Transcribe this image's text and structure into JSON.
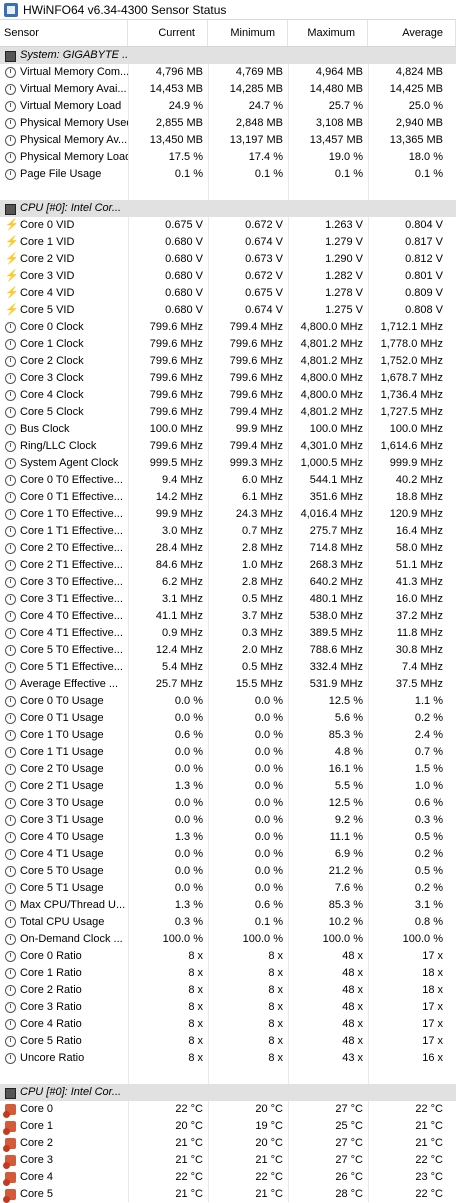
{
  "window": {
    "title": "HWiNFO64 v6.34-4300 Sensor Status"
  },
  "columns": [
    "Sensor",
    "Current",
    "Minimum",
    "Maximum",
    "Average"
  ],
  "colors": {
    "group_bg": "#e1e1e1",
    "voltage_icon": "#f4b400",
    "temp_icon": "#c23b20"
  },
  "rows": [
    {
      "type": "group",
      "icon": "chip-icon",
      "name": "System: GIGABYTE ..."
    },
    {
      "type": "data",
      "icon": "gauge-icon",
      "name": "Virtual Memory Com...",
      "cur": "4,796 MB",
      "min": "4,769 MB",
      "max": "4,964 MB",
      "avg": "4,824 MB"
    },
    {
      "type": "data",
      "icon": "gauge-icon",
      "name": "Virtual Memory Avai...",
      "cur": "14,453 MB",
      "min": "14,285 MB",
      "max": "14,480 MB",
      "avg": "14,425 MB"
    },
    {
      "type": "data",
      "icon": "gauge-icon",
      "name": "Virtual Memory Load",
      "cur": "24.9 %",
      "min": "24.7 %",
      "max": "25.7 %",
      "avg": "25.0 %"
    },
    {
      "type": "data",
      "icon": "gauge-icon",
      "name": "Physical Memory Used",
      "cur": "2,855 MB",
      "min": "2,848 MB",
      "max": "3,108 MB",
      "avg": "2,940 MB"
    },
    {
      "type": "data",
      "icon": "gauge-icon",
      "name": "Physical Memory Av...",
      "cur": "13,450 MB",
      "min": "13,197 MB",
      "max": "13,457 MB",
      "avg": "13,365 MB"
    },
    {
      "type": "data",
      "icon": "gauge-icon",
      "name": "Physical Memory Load",
      "cur": "17.5 %",
      "min": "17.4 %",
      "max": "19.0 %",
      "avg": "18.0 %"
    },
    {
      "type": "data",
      "icon": "gauge-icon",
      "name": "Page File Usage",
      "cur": "0.1 %",
      "min": "0.1 %",
      "max": "0.1 %",
      "avg": "0.1 %"
    },
    {
      "type": "spacer"
    },
    {
      "type": "group",
      "icon": "chip-icon",
      "name": "CPU [#0]: Intel Cor..."
    },
    {
      "type": "data",
      "icon": "voltage-icon",
      "name": "Core 0 VID",
      "cur": "0.675 V",
      "min": "0.672 V",
      "max": "1.263 V",
      "avg": "0.804 V"
    },
    {
      "type": "data",
      "icon": "voltage-icon",
      "name": "Core 1 VID",
      "cur": "0.680 V",
      "min": "0.674 V",
      "max": "1.279 V",
      "avg": "0.817 V"
    },
    {
      "type": "data",
      "icon": "voltage-icon",
      "name": "Core 2 VID",
      "cur": "0.680 V",
      "min": "0.673 V",
      "max": "1.290 V",
      "avg": "0.812 V"
    },
    {
      "type": "data",
      "icon": "voltage-icon",
      "name": "Core 3 VID",
      "cur": "0.680 V",
      "min": "0.672 V",
      "max": "1.282 V",
      "avg": "0.801 V"
    },
    {
      "type": "data",
      "icon": "voltage-icon",
      "name": "Core 4 VID",
      "cur": "0.680 V",
      "min": "0.675 V",
      "max": "1.278 V",
      "avg": "0.809 V"
    },
    {
      "type": "data",
      "icon": "voltage-icon",
      "name": "Core 5 VID",
      "cur": "0.680 V",
      "min": "0.674 V",
      "max": "1.275 V",
      "avg": "0.808 V"
    },
    {
      "type": "data",
      "icon": "gauge-icon",
      "name": "Core 0 Clock",
      "cur": "799.6 MHz",
      "min": "799.4 MHz",
      "max": "4,800.0 MHz",
      "avg": "1,712.1 MHz"
    },
    {
      "type": "data",
      "icon": "gauge-icon",
      "name": "Core 1 Clock",
      "cur": "799.6 MHz",
      "min": "799.6 MHz",
      "max": "4,801.2 MHz",
      "avg": "1,778.0 MHz"
    },
    {
      "type": "data",
      "icon": "gauge-icon",
      "name": "Core 2 Clock",
      "cur": "799.6 MHz",
      "min": "799.6 MHz",
      "max": "4,801.2 MHz",
      "avg": "1,752.0 MHz"
    },
    {
      "type": "data",
      "icon": "gauge-icon",
      "name": "Core 3 Clock",
      "cur": "799.6 MHz",
      "min": "799.6 MHz",
      "max": "4,800.0 MHz",
      "avg": "1,678.7 MHz"
    },
    {
      "type": "data",
      "icon": "gauge-icon",
      "name": "Core 4 Clock",
      "cur": "799.6 MHz",
      "min": "799.6 MHz",
      "max": "4,800.0 MHz",
      "avg": "1,736.4 MHz"
    },
    {
      "type": "data",
      "icon": "gauge-icon",
      "name": "Core 5 Clock",
      "cur": "799.6 MHz",
      "min": "799.4 MHz",
      "max": "4,801.2 MHz",
      "avg": "1,727.5 MHz"
    },
    {
      "type": "data",
      "icon": "gauge-icon",
      "name": "Bus Clock",
      "cur": "100.0 MHz",
      "min": "99.9 MHz",
      "max": "100.0 MHz",
      "avg": "100.0 MHz"
    },
    {
      "type": "data",
      "icon": "gauge-icon",
      "name": "Ring/LLC Clock",
      "cur": "799.6 MHz",
      "min": "799.4 MHz",
      "max": "4,301.0 MHz",
      "avg": "1,614.6 MHz"
    },
    {
      "type": "data",
      "icon": "gauge-icon",
      "name": "System Agent Clock",
      "cur": "999.5 MHz",
      "min": "999.3 MHz",
      "max": "1,000.5 MHz",
      "avg": "999.9 MHz"
    },
    {
      "type": "data",
      "icon": "gauge-icon",
      "name": "Core 0 T0 Effective...",
      "cur": "9.4 MHz",
      "min": "6.0 MHz",
      "max": "544.1 MHz",
      "avg": "40.2 MHz"
    },
    {
      "type": "data",
      "icon": "gauge-icon",
      "name": "Core 0 T1 Effective...",
      "cur": "14.2 MHz",
      "min": "6.1 MHz",
      "max": "351.6 MHz",
      "avg": "18.8 MHz"
    },
    {
      "type": "data",
      "icon": "gauge-icon",
      "name": "Core 1 T0 Effective...",
      "cur": "99.9 MHz",
      "min": "24.3 MHz",
      "max": "4,016.4 MHz",
      "avg": "120.9 MHz"
    },
    {
      "type": "data",
      "icon": "gauge-icon",
      "name": "Core 1 T1 Effective...",
      "cur": "3.0 MHz",
      "min": "0.7 MHz",
      "max": "275.7 MHz",
      "avg": "16.4 MHz"
    },
    {
      "type": "data",
      "icon": "gauge-icon",
      "name": "Core 2 T0 Effective...",
      "cur": "28.4 MHz",
      "min": "2.8 MHz",
      "max": "714.8 MHz",
      "avg": "58.0 MHz"
    },
    {
      "type": "data",
      "icon": "gauge-icon",
      "name": "Core 2 T1 Effective...",
      "cur": "84.6 MHz",
      "min": "1.0 MHz",
      "max": "268.3 MHz",
      "avg": "51.1 MHz"
    },
    {
      "type": "data",
      "icon": "gauge-icon",
      "name": "Core 3 T0 Effective...",
      "cur": "6.2 MHz",
      "min": "2.8 MHz",
      "max": "640.2 MHz",
      "avg": "41.3 MHz"
    },
    {
      "type": "data",
      "icon": "gauge-icon",
      "name": "Core 3 T1 Effective...",
      "cur": "3.1 MHz",
      "min": "0.5 MHz",
      "max": "480.1 MHz",
      "avg": "16.0 MHz"
    },
    {
      "type": "data",
      "icon": "gauge-icon",
      "name": "Core 4 T0 Effective...",
      "cur": "41.1 MHz",
      "min": "3.7 MHz",
      "max": "538.0 MHz",
      "avg": "37.2 MHz"
    },
    {
      "type": "data",
      "icon": "gauge-icon",
      "name": "Core 4 T1 Effective...",
      "cur": "0.9 MHz",
      "min": "0.3 MHz",
      "max": "389.5 MHz",
      "avg": "11.8 MHz"
    },
    {
      "type": "data",
      "icon": "gauge-icon",
      "name": "Core 5 T0 Effective...",
      "cur": "12.4 MHz",
      "min": "2.0 MHz",
      "max": "788.6 MHz",
      "avg": "30.8 MHz"
    },
    {
      "type": "data",
      "icon": "gauge-icon",
      "name": "Core 5 T1 Effective...",
      "cur": "5.4 MHz",
      "min": "0.5 MHz",
      "max": "332.4 MHz",
      "avg": "7.4 MHz"
    },
    {
      "type": "data",
      "icon": "gauge-icon",
      "name": "Average Effective ...",
      "cur": "25.7 MHz",
      "min": "15.5 MHz",
      "max": "531.9 MHz",
      "avg": "37.5 MHz"
    },
    {
      "type": "data",
      "icon": "gauge-icon",
      "name": "Core 0 T0 Usage",
      "cur": "0.0 %",
      "min": "0.0 %",
      "max": "12.5 %",
      "avg": "1.1 %"
    },
    {
      "type": "data",
      "icon": "gauge-icon",
      "name": "Core 0 T1 Usage",
      "cur": "0.0 %",
      "min": "0.0 %",
      "max": "5.6 %",
      "avg": "0.2 %"
    },
    {
      "type": "data",
      "icon": "gauge-icon",
      "name": "Core 1 T0 Usage",
      "cur": "0.6 %",
      "min": "0.0 %",
      "max": "85.3 %",
      "avg": "2.4 %"
    },
    {
      "type": "data",
      "icon": "gauge-icon",
      "name": "Core 1 T1 Usage",
      "cur": "0.0 %",
      "min": "0.0 %",
      "max": "4.8 %",
      "avg": "0.7 %"
    },
    {
      "type": "data",
      "icon": "gauge-icon",
      "name": "Core 2 T0 Usage",
      "cur": "0.0 %",
      "min": "0.0 %",
      "max": "16.1 %",
      "avg": "1.5 %"
    },
    {
      "type": "data",
      "icon": "gauge-icon",
      "name": "Core 2 T1 Usage",
      "cur": "1.3 %",
      "min": "0.0 %",
      "max": "5.5 %",
      "avg": "1.0 %"
    },
    {
      "type": "data",
      "icon": "gauge-icon",
      "name": "Core 3 T0 Usage",
      "cur": "0.0 %",
      "min": "0.0 %",
      "max": "12.5 %",
      "avg": "0.6 %"
    },
    {
      "type": "data",
      "icon": "gauge-icon",
      "name": "Core 3 T1 Usage",
      "cur": "0.0 %",
      "min": "0.0 %",
      "max": "9.2 %",
      "avg": "0.3 %"
    },
    {
      "type": "data",
      "icon": "gauge-icon",
      "name": "Core 4 T0 Usage",
      "cur": "1.3 %",
      "min": "0.0 %",
      "max": "11.1 %",
      "avg": "0.5 %"
    },
    {
      "type": "data",
      "icon": "gauge-icon",
      "name": "Core 4 T1 Usage",
      "cur": "0.0 %",
      "min": "0.0 %",
      "max": "6.9 %",
      "avg": "0.2 %"
    },
    {
      "type": "data",
      "icon": "gauge-icon",
      "name": "Core 5 T0 Usage",
      "cur": "0.0 %",
      "min": "0.0 %",
      "max": "21.2 %",
      "avg": "0.5 %"
    },
    {
      "type": "data",
      "icon": "gauge-icon",
      "name": "Core 5 T1 Usage",
      "cur": "0.0 %",
      "min": "0.0 %",
      "max": "7.6 %",
      "avg": "0.2 %"
    },
    {
      "type": "data",
      "icon": "gauge-icon",
      "name": "Max CPU/Thread U...",
      "cur": "1.3 %",
      "min": "0.6 %",
      "max": "85.3 %",
      "avg": "3.1 %"
    },
    {
      "type": "data",
      "icon": "gauge-icon",
      "name": "Total CPU Usage",
      "cur": "0.3 %",
      "min": "0.1 %",
      "max": "10.2 %",
      "avg": "0.8 %"
    },
    {
      "type": "data",
      "icon": "gauge-icon",
      "name": "On-Demand Clock ...",
      "cur": "100.0 %",
      "min": "100.0 %",
      "max": "100.0 %",
      "avg": "100.0 %"
    },
    {
      "type": "data",
      "icon": "gauge-icon",
      "name": "Core 0 Ratio",
      "cur": "8 x",
      "min": "8 x",
      "max": "48 x",
      "avg": "17 x"
    },
    {
      "type": "data",
      "icon": "gauge-icon",
      "name": "Core 1 Ratio",
      "cur": "8 x",
      "min": "8 x",
      "max": "48 x",
      "avg": "18 x"
    },
    {
      "type": "data",
      "icon": "gauge-icon",
      "name": "Core 2 Ratio",
      "cur": "8 x",
      "min": "8 x",
      "max": "48 x",
      "avg": "18 x"
    },
    {
      "type": "data",
      "icon": "gauge-icon",
      "name": "Core 3 Ratio",
      "cur": "8 x",
      "min": "8 x",
      "max": "48 x",
      "avg": "17 x"
    },
    {
      "type": "data",
      "icon": "gauge-icon",
      "name": "Core 4 Ratio",
      "cur": "8 x",
      "min": "8 x",
      "max": "48 x",
      "avg": "17 x"
    },
    {
      "type": "data",
      "icon": "gauge-icon",
      "name": "Core 5 Ratio",
      "cur": "8 x",
      "min": "8 x",
      "max": "48 x",
      "avg": "17 x"
    },
    {
      "type": "data",
      "icon": "gauge-icon",
      "name": "Uncore Ratio",
      "cur": "8 x",
      "min": "8 x",
      "max": "43 x",
      "avg": "16 x"
    },
    {
      "type": "spacer"
    },
    {
      "type": "group",
      "icon": "chip-icon",
      "name": "CPU [#0]: Intel Cor..."
    },
    {
      "type": "data",
      "icon": "thermometer-icon",
      "name": "Core 0",
      "cur": "22 °C",
      "min": "20 °C",
      "max": "27 °C",
      "avg": "22 °C"
    },
    {
      "type": "data",
      "icon": "thermometer-icon",
      "name": "Core 1",
      "cur": "20 °C",
      "min": "19 °C",
      "max": "25 °C",
      "avg": "21 °C"
    },
    {
      "type": "data",
      "icon": "thermometer-icon",
      "name": "Core 2",
      "cur": "21 °C",
      "min": "20 °C",
      "max": "27 °C",
      "avg": "21 °C"
    },
    {
      "type": "data",
      "icon": "thermometer-icon",
      "name": "Core 3",
      "cur": "21 °C",
      "min": "21 °C",
      "max": "27 °C",
      "avg": "22 °C"
    },
    {
      "type": "data",
      "icon": "thermometer-icon",
      "name": "Core 4",
      "cur": "22 °C",
      "min": "22 °C",
      "max": "26 °C",
      "avg": "23 °C"
    },
    {
      "type": "data",
      "icon": "thermometer-icon",
      "name": "Core 5",
      "cur": "21 °C",
      "min": "21 °C",
      "max": "28 °C",
      "avg": "22 °C"
    }
  ]
}
